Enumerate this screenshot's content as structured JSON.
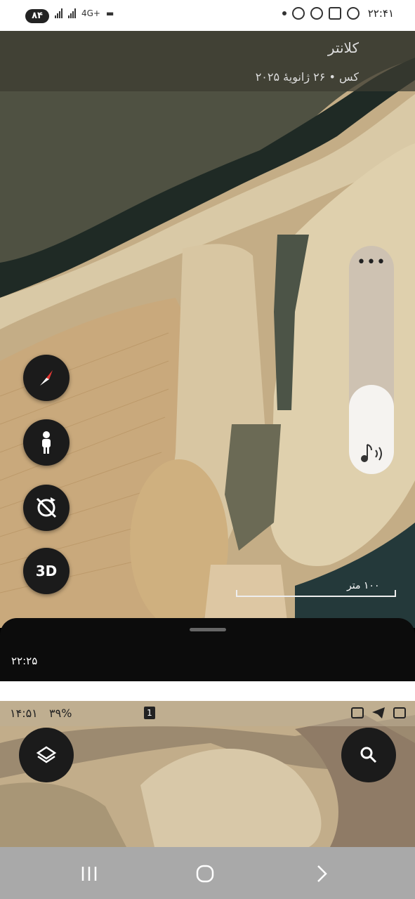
{
  "status_bar": {
    "notification_badge": "۸۴",
    "network": "4G+",
    "time": "۲۲:۴۱"
  },
  "location": {
    "title": "کلانتر",
    "subtitle": "• ۲۶ ژانویهٔ ۲۰۲۵",
    "subtitle_partial": "کس"
  },
  "map_controls": {
    "compass_icon": "compass-icon",
    "pegman_icon": "street-view-icon",
    "rotate_lock_icon": "rotation-lock-icon",
    "three_d_label": "3D"
  },
  "volume": {
    "menu_label": "•••",
    "level": 0.39,
    "icon": "music-note-icon"
  },
  "scale": {
    "label": "۱۰۰ متر"
  },
  "bottom_sheet": {
    "time": "۲۲:۲۵"
  },
  "second_screen": {
    "status_time": "۱۴:۵۱",
    "battery": "۳۹%",
    "sim_badge": "1",
    "layers_icon": "layers-icon",
    "search_icon": "search-icon"
  },
  "nav_bar": {
    "recent_icon": "recent-apps-icon",
    "home_icon": "home-icon",
    "back_icon": "back-icon"
  },
  "colors": {
    "water": "#4f5142",
    "field": "#c9a97c",
    "fab": "#1b1b1b",
    "sheet": "#0c0c0c"
  }
}
